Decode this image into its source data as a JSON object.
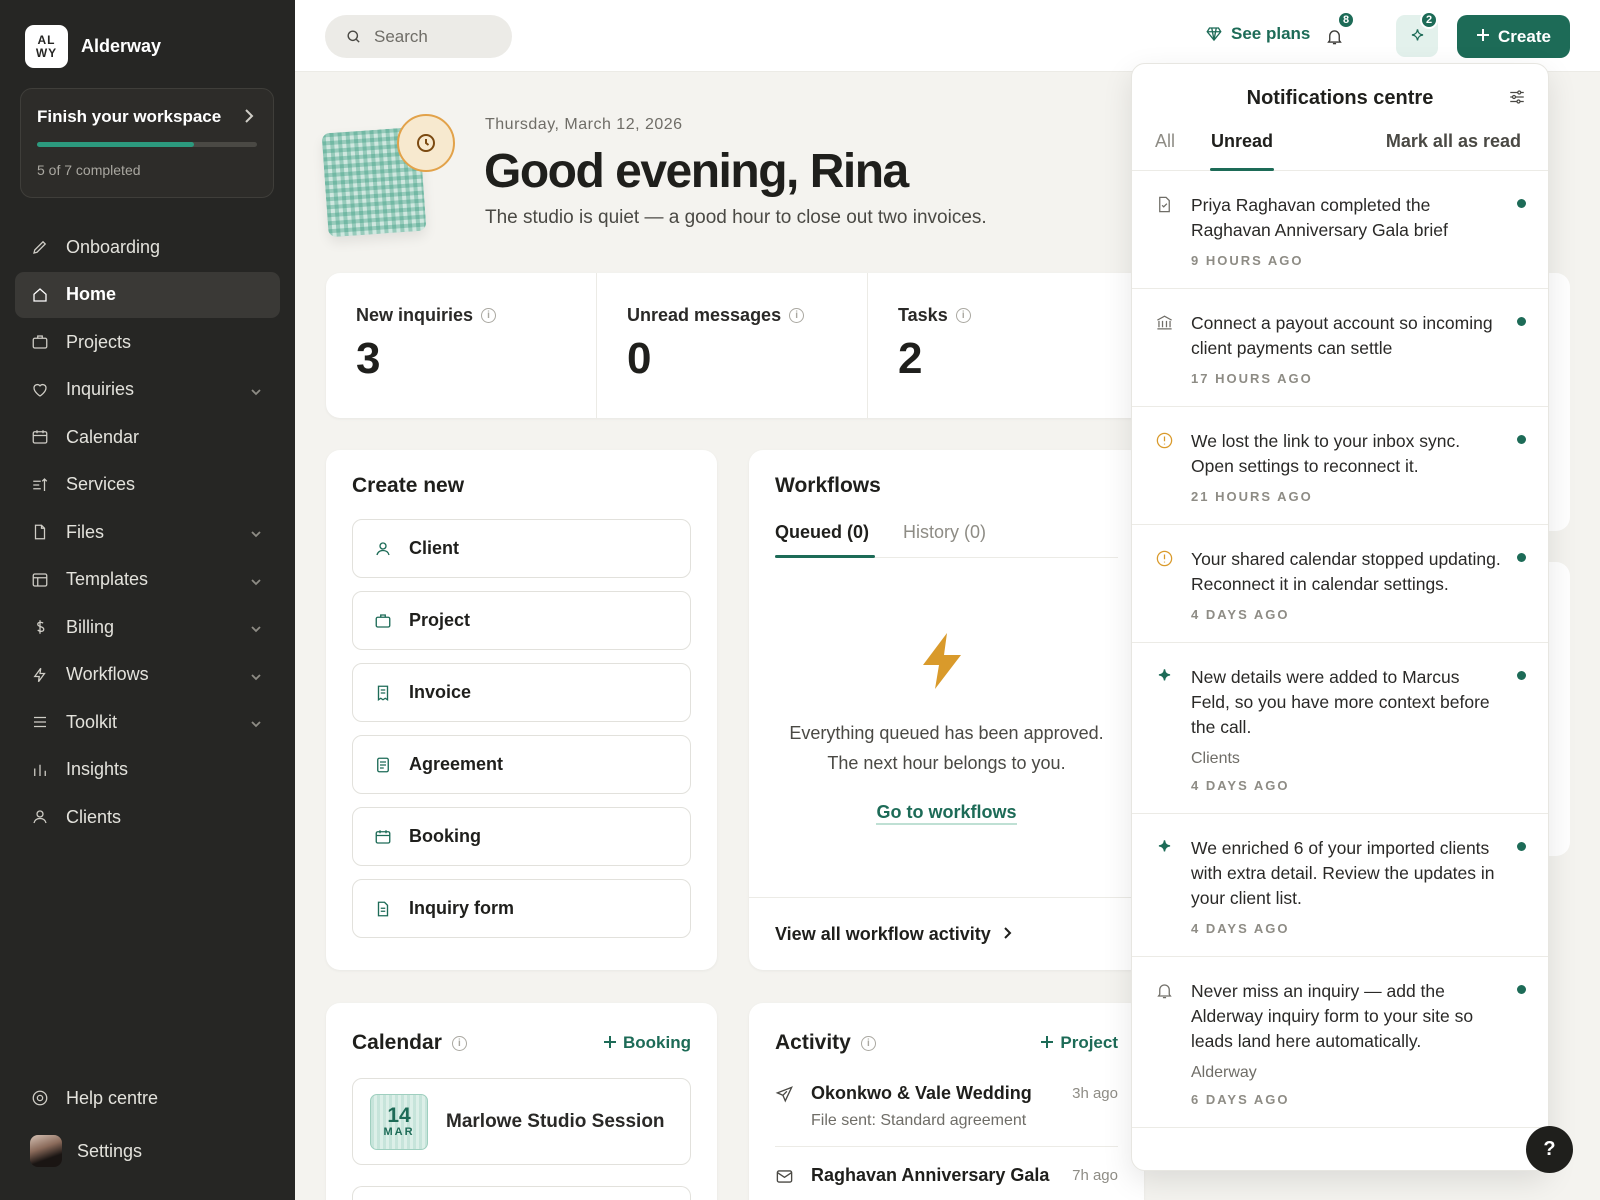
{
  "brand": {
    "logo_line1": "AL",
    "logo_line2": "WY",
    "name": "Alderway"
  },
  "finish": {
    "title": "Finish your workspace",
    "progress": "5 of 7 completed",
    "completed": 5,
    "total": 7
  },
  "nav": [
    {
      "label": "Onboarding",
      "icon": "pencil-icon",
      "chevron": false
    },
    {
      "label": "Home",
      "icon": "home-icon",
      "chevron": false,
      "active": true
    },
    {
      "label": "Projects",
      "icon": "briefcase-icon",
      "chevron": false
    },
    {
      "label": "Inquiries",
      "icon": "heart-icon",
      "chevron": true
    },
    {
      "label": "Calendar",
      "icon": "calendar-icon",
      "chevron": false
    },
    {
      "label": "Services",
      "icon": "services-icon",
      "chevron": false
    },
    {
      "label": "Files",
      "icon": "file-icon",
      "chevron": true
    },
    {
      "label": "Templates",
      "icon": "template-icon",
      "chevron": true
    },
    {
      "label": "Billing",
      "icon": "dollar-icon",
      "chevron": true
    },
    {
      "label": "Workflows",
      "icon": "bolt-icon",
      "chevron": true
    },
    {
      "label": "Toolkit",
      "icon": "menu-icon",
      "chevron": true
    },
    {
      "label": "Insights",
      "icon": "bar-chart-icon",
      "chevron": false
    },
    {
      "label": "Clients",
      "icon": "user-icon",
      "chevron": false
    }
  ],
  "sidebar_bottom": {
    "help": "Help centre",
    "settings": "Settings"
  },
  "topbar": {
    "search_placeholder": "Search",
    "see_plans": "See plans",
    "bell_badge": "8",
    "spark_badge": "2",
    "create": "Create"
  },
  "greeting": {
    "date": "Thursday, March 12, 2026",
    "title": "Good evening, Rina",
    "subtitle": "The studio is quiet — a good hour to close out two invoices."
  },
  "stats": [
    {
      "label": "New inquiries",
      "value": "3"
    },
    {
      "label": "Unread messages",
      "value": "0"
    },
    {
      "label": "Tasks",
      "value": "2"
    }
  ],
  "create_new": {
    "title": "Create new",
    "items": [
      "Client",
      "Project",
      "Invoice",
      "Agreement",
      "Booking",
      "Inquiry form"
    ]
  },
  "workflows": {
    "title": "Workflows",
    "tab_queued": "Queued (0)",
    "tab_history": "History (0)",
    "empty_line1": "Everything queued has been approved.",
    "empty_line2": "The next hour belongs to you.",
    "link": "Go to workflows",
    "footer": "View all workflow activity"
  },
  "calendar": {
    "title": "Calendar",
    "action": "Booking",
    "event_day": "14",
    "event_month": "MAR",
    "event_title": "Marlowe Studio Session"
  },
  "activity": {
    "title": "Activity",
    "action": "Project",
    "items": [
      {
        "title": "Okonkwo & Vale Wedding",
        "sub": "File sent: Standard agreement",
        "time": "3h ago"
      },
      {
        "title": "Raghavan Anniversary Gala",
        "sub": "",
        "time": "7h ago"
      }
    ]
  },
  "notifications": {
    "title": "Notifications centre",
    "tab_all": "All",
    "tab_unread": "Unread",
    "mark_all": "Mark all as read",
    "items": [
      {
        "icon": "document-check-icon",
        "text": "Priya Raghavan completed the Raghavan Anniversary Gala brief",
        "tag": "",
        "time": "9 HOURS AGO"
      },
      {
        "icon": "bank-icon",
        "text": "Connect a payout account so incoming client payments can settle",
        "tag": "",
        "time": "17 HOURS AGO"
      },
      {
        "icon": "alert-circle-icon",
        "text": "We lost the link to your inbox sync. Open settings to reconnect it.",
        "tag": "",
        "time": "21 HOURS AGO"
      },
      {
        "icon": "alert-circle-icon",
        "text": "Your shared calendar stopped updating. Reconnect it in calendar settings.",
        "tag": "",
        "time": "4 DAYS AGO"
      },
      {
        "icon": "sparkle-icon",
        "text": "New details were added to Marcus Feld, so you have more context before the call.",
        "tag": "Clients",
        "time": "4 DAYS AGO"
      },
      {
        "icon": "sparkle-icon",
        "text": "We enriched 6 of your imported clients with extra detail. Review the updates in your client list.",
        "tag": "",
        "time": "4 DAYS AGO"
      },
      {
        "icon": "bell-icon",
        "text": "Never miss an inquiry — add the Alderway inquiry form to your site so leads land here automatically.",
        "tag": "Alderway",
        "time": "6 DAYS AGO"
      }
    ]
  },
  "help_fab": "?",
  "colors": {
    "accent": "#1d6b57",
    "sidebar": "#262624",
    "warning": "#d99a2b"
  }
}
